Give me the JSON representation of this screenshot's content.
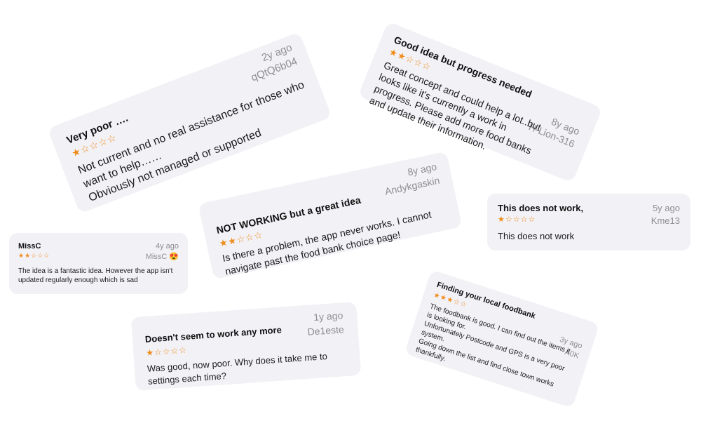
{
  "colors": {
    "card_bg": "#f2f1f6",
    "star": "#f08a17",
    "meta": "#8e8e93"
  },
  "reviews": [
    {
      "title": "Very poor ….",
      "stars_text": "★☆☆☆☆",
      "rating": 1,
      "age": "2y ago",
      "author": "qQtQ6b04",
      "body": "Not current and no real assistance for those who want to help……\nObviously not managed or supported"
    },
    {
      "title": "Good idea but progress needed",
      "stars_text": "★★☆☆☆",
      "rating": 2,
      "age": "8y ago",
      "author": "H-Lion-316",
      "body": "Great concept and could help a lot..but looks like it's currently a work in progress. Please add more food banks and update their information."
    },
    {
      "title": "NOT WORKING but a great idea",
      "stars_text": "★★☆☆☆",
      "rating": 2,
      "age": "8y ago",
      "author": "Andykgaskin",
      "body": "Is there a problem, the app never works. I cannot navigate past the food bank choice page!"
    },
    {
      "title": "This does not work,",
      "stars_text": "★☆☆☆☆",
      "rating": 1,
      "age": "5y ago",
      "author": "Kme13",
      "body": "This does not work"
    },
    {
      "title": "MissC",
      "stars_text": "★★☆☆☆",
      "rating": 2,
      "age": "4y ago",
      "author": "MissC 😍",
      "body": "The idea is a fantastic idea. However the app isn't updated regularly enough which is sad"
    },
    {
      "title": "Doesn't seem to work any more",
      "stars_text": "★☆☆☆☆",
      "rating": 1,
      "age": "1y ago",
      "author": "De1este",
      "body": "Was good, now poor. Why does it take me to settings each time?"
    },
    {
      "title": "Finding your local foodbank",
      "stars_text": "★★★☆☆",
      "rating": 3,
      "age": "3y ago",
      "author": "A0K",
      "body": "The foodbank is good. I can find out the items it is looking for.\nUnfortunately Postcode and GPS is a very poor system.\nGoing down the list and find close town works thankfully."
    }
  ]
}
